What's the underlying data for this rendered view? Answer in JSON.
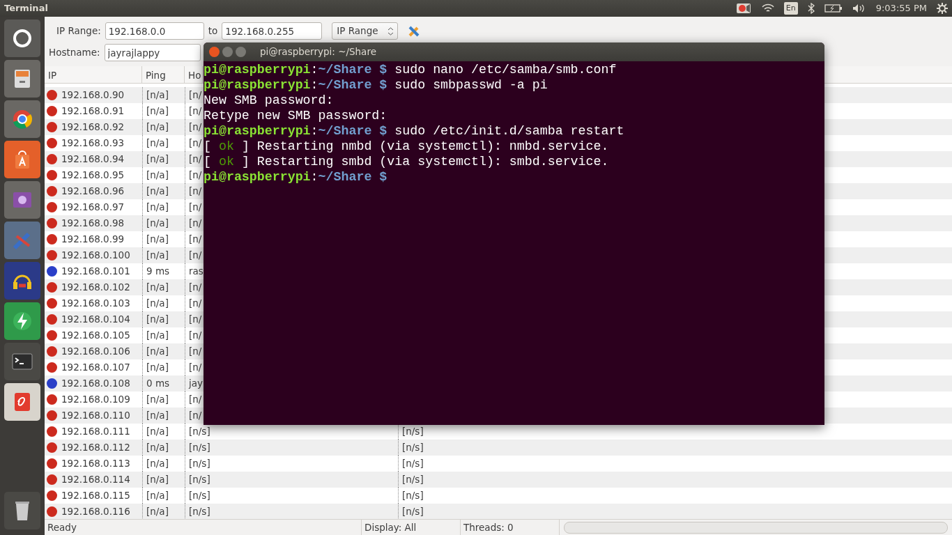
{
  "top_panel": {
    "title": "Terminal",
    "keyboard_layout": "En",
    "clock": "9:03:55 PM"
  },
  "toolbar": {
    "range_label": "IP Range:",
    "range_from": "192.168.0.0",
    "to_label": "to",
    "range_to": "192.168.0.255",
    "mode": "IP Range",
    "hostname_label": "Hostname:",
    "hostname": "jayrajlappy"
  },
  "table": {
    "columns": [
      "IP",
      "Ping",
      "Ho"
    ],
    "rows": [
      {
        "ip": "192.168.0.90",
        "ping": "[n/a]",
        "column_3": "[n/",
        "color": "#cc2a1e"
      },
      {
        "ip": "192.168.0.91",
        "ping": "[n/a]",
        "column_3": "[n/",
        "color": "#cc2a1e"
      },
      {
        "ip": "192.168.0.92",
        "ping": "[n/a]",
        "column_3": "[n/",
        "color": "#cc2a1e"
      },
      {
        "ip": "192.168.0.93",
        "ping": "[n/a]",
        "column_3": "[n/",
        "color": "#cc2a1e"
      },
      {
        "ip": "192.168.0.94",
        "ping": "[n/a]",
        "column_3": "[n/",
        "color": "#cc2a1e"
      },
      {
        "ip": "192.168.0.95",
        "ping": "[n/a]",
        "column_3": "[n/",
        "color": "#cc2a1e"
      },
      {
        "ip": "192.168.0.96",
        "ping": "[n/a]",
        "column_3": "[n/",
        "color": "#cc2a1e"
      },
      {
        "ip": "192.168.0.97",
        "ping": "[n/a]",
        "column_3": "[n/",
        "color": "#cc2a1e"
      },
      {
        "ip": "192.168.0.98",
        "ping": "[n/a]",
        "column_3": "[n/",
        "color": "#cc2a1e"
      },
      {
        "ip": "192.168.0.99",
        "ping": "[n/a]",
        "column_3": "[n/",
        "color": "#cc2a1e"
      },
      {
        "ip": "192.168.0.100",
        "ping": "[n/a]",
        "column_3": "[n/",
        "color": "#cc2a1e"
      },
      {
        "ip": "192.168.0.101",
        "ping": "9 ms",
        "column_3": "ras",
        "color": "#2a3fc8"
      },
      {
        "ip": "192.168.0.102",
        "ping": "[n/a]",
        "column_3": "[n/",
        "color": "#cc2a1e"
      },
      {
        "ip": "192.168.0.103",
        "ping": "[n/a]",
        "column_3": "[n/",
        "color": "#cc2a1e"
      },
      {
        "ip": "192.168.0.104",
        "ping": "[n/a]",
        "column_3": "[n/",
        "color": "#cc2a1e"
      },
      {
        "ip": "192.168.0.105",
        "ping": "[n/a]",
        "column_3": "[n/",
        "color": "#cc2a1e"
      },
      {
        "ip": "192.168.0.106",
        "ping": "[n/a]",
        "column_3": "[n/",
        "color": "#cc2a1e"
      },
      {
        "ip": "192.168.0.107",
        "ping": "[n/a]",
        "column_3": "[n/",
        "color": "#cc2a1e"
      },
      {
        "ip": "192.168.0.108",
        "ping": "0 ms",
        "column_3": "jay",
        "color": "#2a3fc8"
      },
      {
        "ip": "192.168.0.109",
        "ping": "[n/a]",
        "column_3": "[n/",
        "color": "#cc2a1e"
      },
      {
        "ip": "192.168.0.110",
        "ping": "[n/a]",
        "column_3": "[n/",
        "color": "#cc2a1e"
      },
      {
        "ip": "192.168.0.111",
        "ping": "[n/a]",
        "column_3": "[n/s]",
        "column_4": "[n/s]",
        "color": "#cc2a1e"
      },
      {
        "ip": "192.168.0.112",
        "ping": "[n/a]",
        "column_3": "[n/s]",
        "column_4": "[n/s]",
        "color": "#cc2a1e"
      },
      {
        "ip": "192.168.0.113",
        "ping": "[n/a]",
        "column_3": "[n/s]",
        "column_4": "[n/s]",
        "color": "#cc2a1e"
      },
      {
        "ip": "192.168.0.114",
        "ping": "[n/a]",
        "column_3": "[n/s]",
        "column_4": "[n/s]",
        "color": "#cc2a1e"
      },
      {
        "ip": "192.168.0.115",
        "ping": "[n/a]",
        "column_3": "[n/s]",
        "column_4": "[n/s]",
        "color": "#cc2a1e"
      },
      {
        "ip": "192.168.0.116",
        "ping": "[n/a]",
        "column_3": "[n/s]",
        "column_4": "[n/s]",
        "color": "#cc2a1e"
      }
    ]
  },
  "status_bar": {
    "state": "Ready",
    "display": "Display: All",
    "threads": "Threads: 0",
    "progress": {
      "level": 0
    }
  },
  "terminal": {
    "title": "pi@raspberrypi: ~/Share",
    "lines": [
      [
        {
          "kind": "user",
          "text": "pi@raspberrypi"
        },
        {
          "kind": "text",
          "text": ":"
        },
        {
          "kind": "path",
          "text": "~/Share $"
        },
        {
          "kind": "text",
          "text": " sudo nano /etc/samba/smb.conf"
        }
      ],
      [
        {
          "kind": "user",
          "text": "pi@raspberrypi"
        },
        {
          "kind": "text",
          "text": ":"
        },
        {
          "kind": "path",
          "text": "~/Share $"
        },
        {
          "kind": "text",
          "text": " sudo smbpasswd -a pi"
        }
      ],
      [
        {
          "kind": "text",
          "text": "New SMB password:"
        }
      ],
      [
        {
          "kind": "text",
          "text": "Retype new SMB password:"
        }
      ],
      [
        {
          "kind": "user",
          "text": "pi@raspberrypi"
        },
        {
          "kind": "text",
          "text": ":"
        },
        {
          "kind": "path",
          "text": "~/Share $"
        },
        {
          "kind": "text",
          "text": " sudo /etc/init.d/samba restart"
        }
      ],
      [
        {
          "kind": "text",
          "text": "[ "
        },
        {
          "kind": "ok",
          "text": "ok"
        },
        {
          "kind": "text",
          "text": " ] Restarting nmbd (via systemctl): nmbd.service."
        }
      ],
      [
        {
          "kind": "text",
          "text": "[ "
        },
        {
          "kind": "ok",
          "text": "ok"
        },
        {
          "kind": "text",
          "text": " ] Restarting smbd (via systemctl): smbd.service."
        }
      ],
      [
        {
          "kind": "user",
          "text": "pi@raspberrypi"
        },
        {
          "kind": "text",
          "text": ":"
        },
        {
          "kind": "path",
          "text": "~/Share $"
        }
      ]
    ]
  }
}
